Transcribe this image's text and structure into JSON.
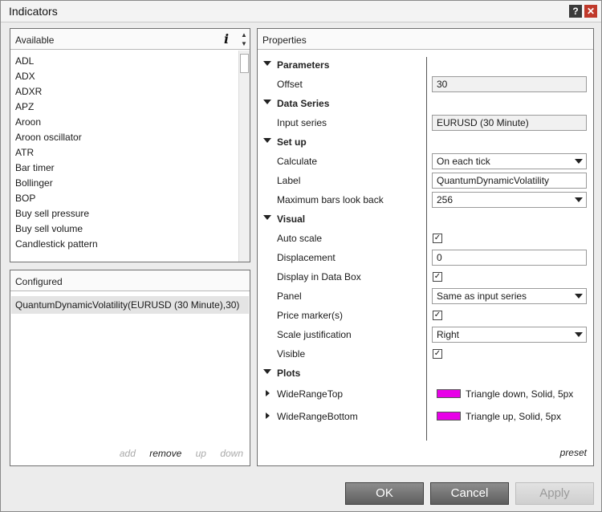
{
  "window": {
    "title": "Indicators",
    "help_label": "?",
    "close_label": "✕"
  },
  "available": {
    "header": "Available",
    "info_label": "i",
    "items": [
      "ADL",
      "ADX",
      "ADXR",
      "APZ",
      "Aroon",
      "Aroon oscillator",
      "ATR",
      "Bar timer",
      "Bollinger",
      "BOP",
      "Buy sell pressure",
      "Buy sell volume",
      "Candlestick pattern"
    ]
  },
  "configured": {
    "header": "Configured",
    "items": [
      "QuantumDynamicVolatility(EURUSD (30 Minute),30)"
    ],
    "actions": {
      "add": "add",
      "remove": "remove",
      "up": "up",
      "down": "down"
    }
  },
  "properties": {
    "header": "Properties",
    "categories": {
      "parameters": "Parameters",
      "data_series": "Data Series",
      "setup": "Set up",
      "visual": "Visual",
      "plots": "Plots"
    },
    "fields": {
      "offset": {
        "label": "Offset",
        "value": "30"
      },
      "input_series": {
        "label": "Input series",
        "value": "EURUSD (30 Minute)"
      },
      "calculate": {
        "label": "Calculate",
        "value": "On each tick"
      },
      "label": {
        "label": "Label",
        "value": "QuantumDynamicVolatility"
      },
      "max_bars": {
        "label": "Maximum bars look back",
        "value": "256"
      },
      "auto_scale": {
        "label": "Auto scale",
        "checked": true
      },
      "displacement": {
        "label": "Displacement",
        "value": "0"
      },
      "display_data_box": {
        "label": "Display in Data Box",
        "checked": true
      },
      "panel": {
        "label": "Panel",
        "value": "Same as input series"
      },
      "price_marker": {
        "label": "Price marker(s)",
        "checked": true
      },
      "scale_justification": {
        "label": "Scale justification",
        "value": "Right"
      },
      "visible": {
        "label": "Visible",
        "checked": true
      }
    },
    "plots": [
      {
        "name": "WideRangeTop",
        "style": "Triangle down, Solid, 5px",
        "color": "#e800e8"
      },
      {
        "name": "WideRangeBottom",
        "style": "Triangle up, Solid, 5px",
        "color": "#e800e8"
      }
    ],
    "preset_label": "preset"
  },
  "buttons": {
    "ok": "OK",
    "cancel": "Cancel",
    "apply": "Apply"
  },
  "icons": {
    "collapse": "triangle-down-icon",
    "expand": "triangle-right-icon",
    "check": "✓"
  }
}
